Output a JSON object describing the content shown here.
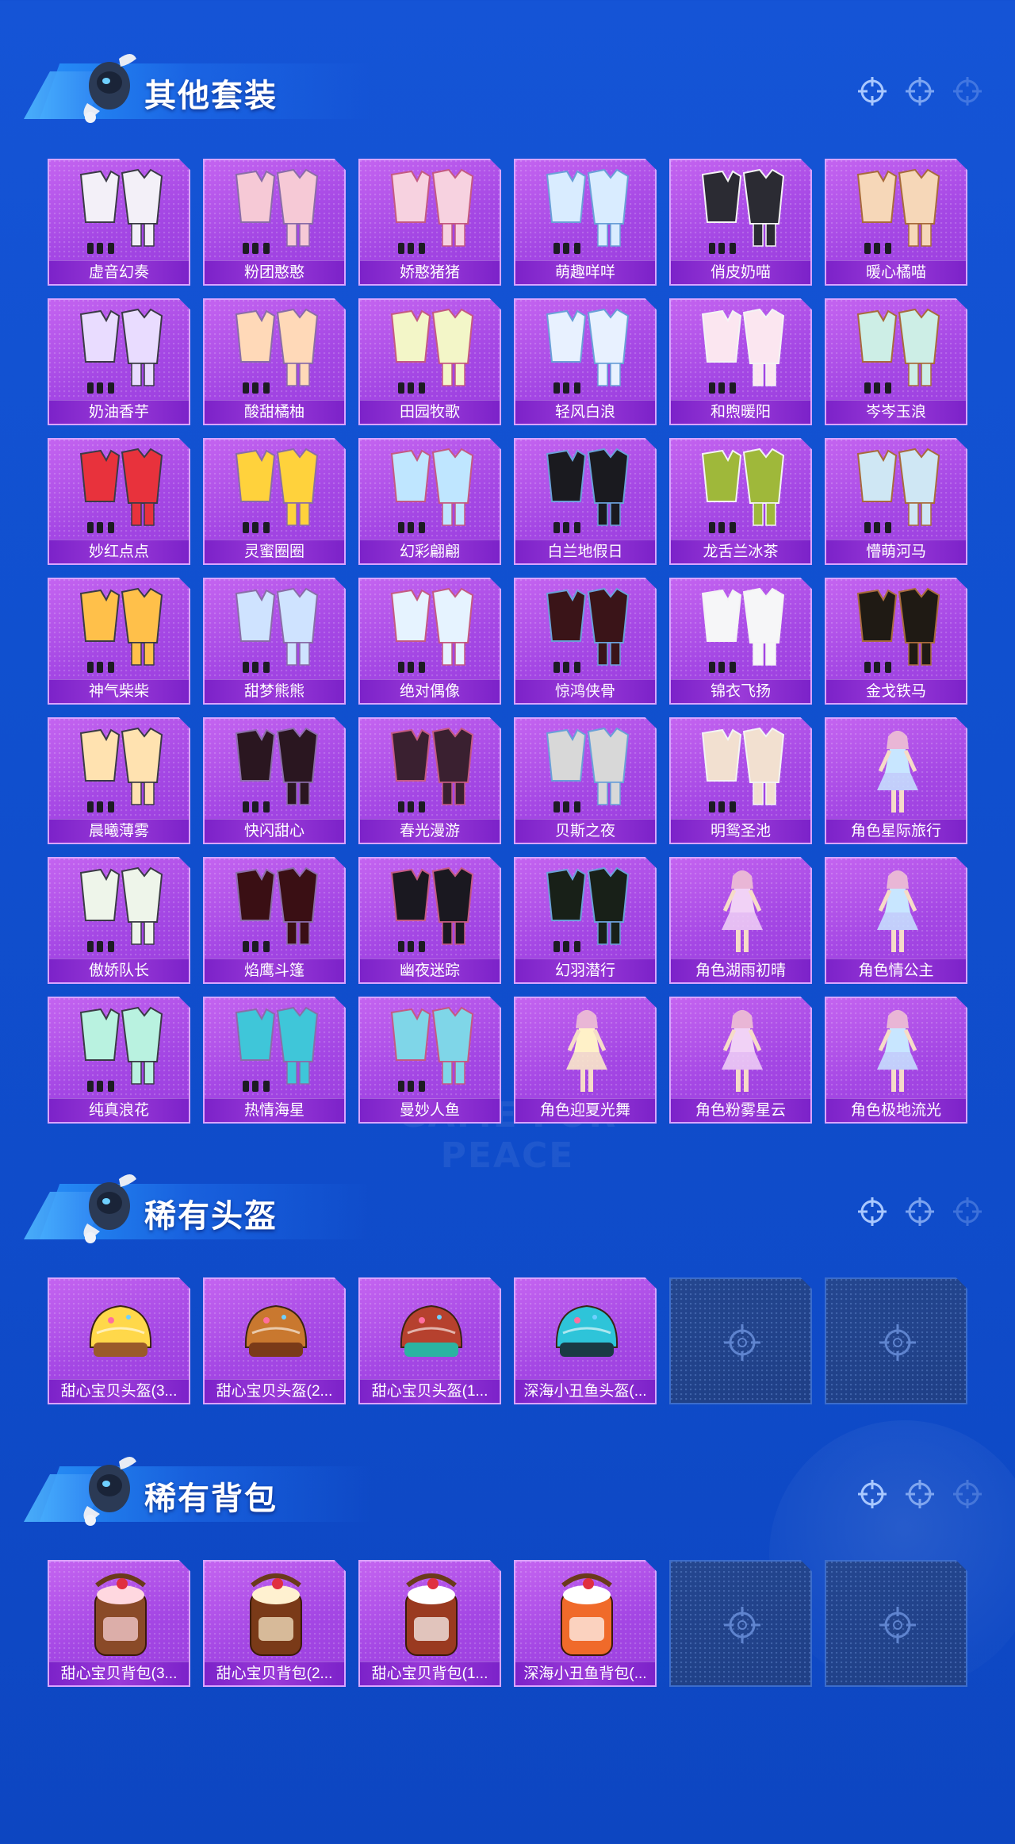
{
  "sections": [
    {
      "title": "其他套装",
      "items": [
        {
          "label": "虚音幻奏",
          "art": "outfit-icon"
        },
        {
          "label": "粉团憨憨",
          "art": "outfit-icon"
        },
        {
          "label": "娇憨猪猪",
          "art": "outfit-icon"
        },
        {
          "label": "萌趣咩咩",
          "art": "outfit-icon"
        },
        {
          "label": "俏皮奶喵",
          "art": "outfit-icon"
        },
        {
          "label": "暖心橘喵",
          "art": "outfit-icon"
        },
        {
          "label": "奶油香芋",
          "art": "outfit-icon"
        },
        {
          "label": "酸甜橘柚",
          "art": "outfit-icon"
        },
        {
          "label": "田园牧歌",
          "art": "outfit-icon"
        },
        {
          "label": "轻风白浪",
          "art": "outfit-icon"
        },
        {
          "label": "和煦暖阳",
          "art": "outfit-icon"
        },
        {
          "label": "岑岑玉浪",
          "art": "outfit-icon"
        },
        {
          "label": "妙红点点",
          "art": "outfit-icon"
        },
        {
          "label": "灵蜜圈圈",
          "art": "outfit-icon"
        },
        {
          "label": "幻彩翩翩",
          "art": "outfit-icon"
        },
        {
          "label": "白兰地假日",
          "art": "outfit-icon"
        },
        {
          "label": "龙舌兰冰茶",
          "art": "outfit-icon"
        },
        {
          "label": "懵萌河马",
          "art": "outfit-icon"
        },
        {
          "label": "神气柴柴",
          "art": "outfit-icon"
        },
        {
          "label": "甜梦熊熊",
          "art": "outfit-icon"
        },
        {
          "label": "绝对偶像",
          "art": "outfit-icon"
        },
        {
          "label": "惊鸿侠骨",
          "art": "outfit-icon"
        },
        {
          "label": "锦衣飞扬",
          "art": "outfit-icon"
        },
        {
          "label": "金戈铁马",
          "art": "outfit-icon"
        },
        {
          "label": "晨曦薄雾",
          "art": "outfit-icon"
        },
        {
          "label": "快闪甜心",
          "art": "outfit-icon"
        },
        {
          "label": "春光漫游",
          "art": "outfit-icon"
        },
        {
          "label": "贝斯之夜",
          "art": "outfit-icon"
        },
        {
          "label": "明鸳圣池",
          "art": "outfit-icon"
        },
        {
          "label": "角色星际旅行",
          "art": "character-icon"
        },
        {
          "label": "傲娇队长",
          "art": "outfit-icon"
        },
        {
          "label": "焰鹰斗篷",
          "art": "outfit-icon"
        },
        {
          "label": "幽夜迷踪",
          "art": "outfit-icon"
        },
        {
          "label": "幻羽潜行",
          "art": "outfit-icon"
        },
        {
          "label": "角色湖雨初晴",
          "art": "character-icon"
        },
        {
          "label": "角色情公主",
          "art": "character-icon"
        },
        {
          "label": "纯真浪花",
          "art": "outfit-icon"
        },
        {
          "label": "热情海星",
          "art": "outfit-icon"
        },
        {
          "label": "曼妙人鱼",
          "art": "outfit-icon"
        },
        {
          "label": "角色迎夏光舞",
          "art": "character-icon"
        },
        {
          "label": "角色粉雾星云",
          "art": "character-icon"
        },
        {
          "label": "角色极地流光",
          "art": "character-icon"
        }
      ]
    },
    {
      "title": "稀有头盔",
      "items": [
        {
          "label": "甜心宝贝头盔(3...",
          "art": "helmet-icon"
        },
        {
          "label": "甜心宝贝头盔(2...",
          "art": "helmet-icon"
        },
        {
          "label": "甜心宝贝头盔(1...",
          "art": "helmet-icon"
        },
        {
          "label": "深海小丑鱼头盔(...",
          "art": "helmet-icon"
        },
        {
          "label": "",
          "art": "empty-slot-icon",
          "empty": true
        },
        {
          "label": "",
          "art": "empty-slot-icon",
          "empty": true
        }
      ]
    },
    {
      "title": "稀有背包",
      "items": [
        {
          "label": "甜心宝贝背包(3...",
          "art": "backpack-icon"
        },
        {
          "label": "甜心宝贝背包(2...",
          "art": "backpack-icon"
        },
        {
          "label": "甜心宝贝背包(1...",
          "art": "backpack-icon"
        },
        {
          "label": "深海小丑鱼背包(...",
          "art": "backpack-icon"
        },
        {
          "label": "",
          "art": "empty-slot-icon",
          "empty": true
        },
        {
          "label": "",
          "art": "empty-slot-icon",
          "empty": true
        }
      ]
    }
  ],
  "watermark": "GAME FOR PEACE",
  "colors": {
    "background": "#1050cf",
    "card": "#a447e4",
    "label_bar": "#7c22c9",
    "empty_card": "#1f3f86"
  }
}
